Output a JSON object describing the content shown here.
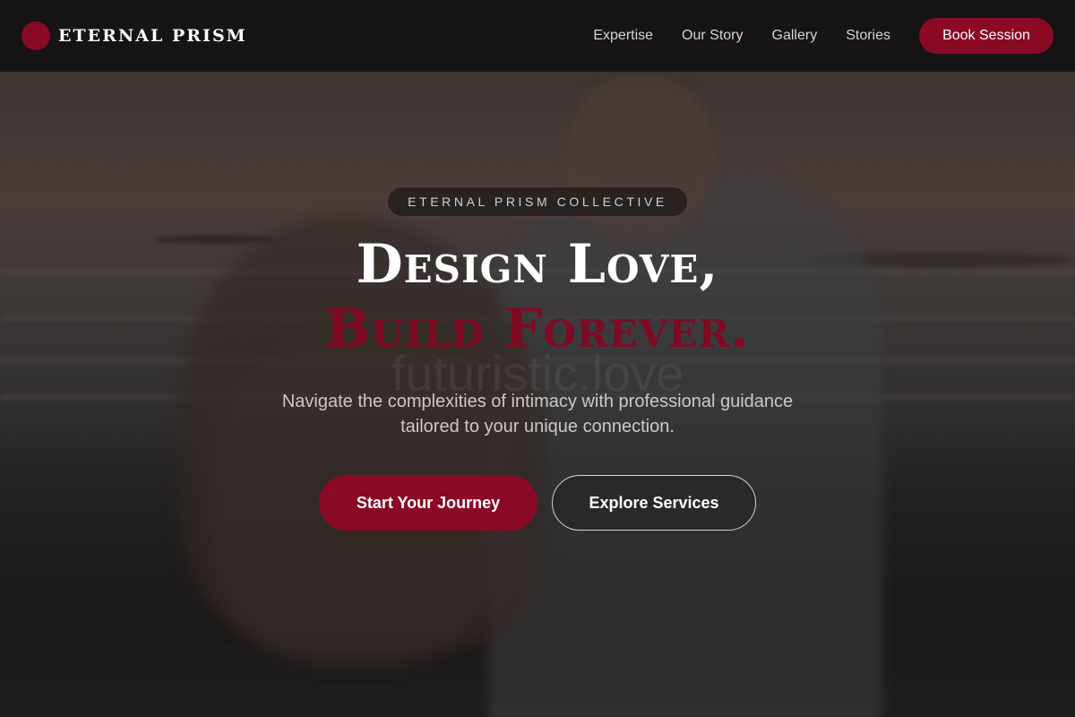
{
  "brand": {
    "name": "ETERNAL PRISM",
    "accent": "#8a0a26"
  },
  "nav": {
    "links": [
      "Expertise",
      "Our Story",
      "Gallery",
      "Stories"
    ],
    "cta": "Book Session"
  },
  "hero": {
    "badge": "ETERNAL PRISM COLLECTIVE",
    "title_line1": "Design Love,",
    "title_line2": "Build Forever.",
    "watermark": "futuristic.love",
    "subtitle": "Navigate the complexities of intimacy with professional guidance tailored to your unique connection.",
    "primary_button": "Start Your Journey",
    "secondary_button": "Explore Services",
    "background_image": "couple-on-beach-at-sunset-photo"
  }
}
